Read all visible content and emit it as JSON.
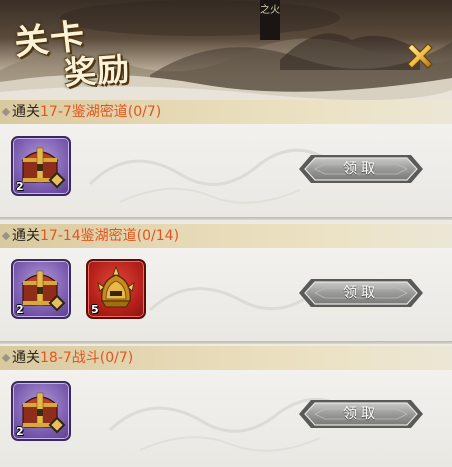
{
  "header": {
    "title_line1": "关卡",
    "title_line2": "奖励",
    "seal_text": "之火"
  },
  "colors": {
    "highlight_orange": "#e2561e",
    "claim_button_gray": "#9a9a98",
    "rarity_purple": "#7d5fb2",
    "rarity_red": "#b5211a"
  },
  "sections": [
    {
      "prefix": "通关",
      "detail": "17-7鉴湖密道(0/7)",
      "rewards": [
        {
          "icon": "treasure-chest-icon",
          "rarity": "purple",
          "count": "2"
        }
      ],
      "claim_label": "领取"
    },
    {
      "prefix": "通关",
      "detail": "17-14鉴湖密道(0/14)",
      "rewards": [
        {
          "icon": "treasure-chest-icon",
          "rarity": "purple",
          "count": "2"
        },
        {
          "icon": "golden-helmet-icon",
          "rarity": "red",
          "count": "5"
        }
      ],
      "claim_label": "领取"
    },
    {
      "prefix": "通关",
      "detail": "18-7战斗(0/7)",
      "rewards": [
        {
          "icon": "treasure-chest-icon",
          "rarity": "purple",
          "count": "2"
        }
      ],
      "claim_label": "领取"
    }
  ]
}
